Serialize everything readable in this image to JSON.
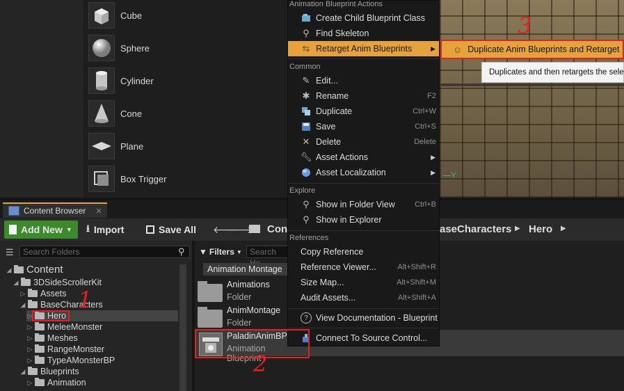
{
  "place_panel": {
    "items": [
      {
        "label": "Cube",
        "icon": "cube-icon"
      },
      {
        "label": "Sphere",
        "icon": "sphere-icon"
      },
      {
        "label": "Cylinder",
        "icon": "cylinder-icon"
      },
      {
        "label": "Cone",
        "icon": "cone-icon"
      },
      {
        "label": "Plane",
        "icon": "plane-icon"
      },
      {
        "label": "Box Trigger",
        "icon": "box-trigger-icon"
      }
    ]
  },
  "viewport": {
    "axis_label": "Y"
  },
  "context_menu": {
    "sections": [
      {
        "title": "Animation Blueprint Actions",
        "items": [
          {
            "label": "Create Child Blueprint Class",
            "icon": "blueprint-icon"
          },
          {
            "label": "Find Skeleton",
            "icon": "find-icon"
          },
          {
            "label": "Retarget Anim Blueprints",
            "icon": "retarget-icon",
            "submenu": true
          }
        ]
      },
      {
        "title": "Common",
        "items": [
          {
            "label": "Edit...",
            "icon": "edit-icon",
            "shortcut": ""
          },
          {
            "label": "Rename",
            "icon": "rename-icon",
            "shortcut": "F2"
          },
          {
            "label": "Duplicate",
            "icon": "duplicate-icon",
            "shortcut": "Ctrl+W"
          },
          {
            "label": "Save",
            "icon": "save-icon",
            "shortcut": "Ctrl+S"
          },
          {
            "label": "Delete",
            "icon": "delete-icon",
            "shortcut": "Delete"
          },
          {
            "label": "Asset Actions",
            "icon": "wrench-icon",
            "submenu": true
          },
          {
            "label": "Asset Localization",
            "icon": "globe-icon",
            "submenu": true
          }
        ]
      },
      {
        "title": "Explore",
        "items": [
          {
            "label": "Show in Folder View",
            "icon": "find-icon",
            "shortcut": "Ctrl+B"
          },
          {
            "label": "Show in Explorer",
            "icon": "find-icon",
            "shortcut": ""
          }
        ]
      },
      {
        "title": "References",
        "items": [
          {
            "label": "Copy Reference",
            "shortcut": ""
          },
          {
            "label": "Reference Viewer...",
            "shortcut": "Alt+Shift+R"
          },
          {
            "label": "Size Map...",
            "shortcut": "Alt+Shift+M"
          },
          {
            "label": "Audit Assets...",
            "shortcut": "Alt+Shift+A"
          }
        ]
      }
    ],
    "documentation": "View Documentation - Blueprint",
    "source_control": "Connect To Source Control..."
  },
  "submenu": {
    "label": "Duplicate Anim Blueprints and Retarget"
  },
  "tooltip": {
    "text": "Duplicates and then retargets the selec"
  },
  "content_browser": {
    "tab_label": "Content Browser",
    "toolbar": {
      "add_new": "Add New",
      "import": "Import",
      "save_all": "Save All"
    },
    "breadcrumb": [
      "Cont",
      "aseCharacters",
      "Hero"
    ],
    "search_folders_placeholder": "Search Folders",
    "filters_label": "Filters",
    "search_assets_placeholder": "Search He",
    "filter_chip": "Animation Montage",
    "tree": [
      {
        "label": "Content",
        "level": 0,
        "expanded": true
      },
      {
        "label": "3DSideScrollerKit",
        "level": 1,
        "expanded": true
      },
      {
        "label": "Assets",
        "level": 2,
        "expanded": false
      },
      {
        "label": "BaseCharacters",
        "level": 2,
        "expanded": true
      },
      {
        "label": "Hero",
        "level": 3,
        "expanded": false,
        "selected": true
      },
      {
        "label": "MeleeMonster",
        "level": 3,
        "expanded": false
      },
      {
        "label": "Meshes",
        "level": 3,
        "expanded": false
      },
      {
        "label": "RangeMonster",
        "level": 3,
        "expanded": false
      },
      {
        "label": "TypeAMonsterBP",
        "level": 3,
        "expanded": false
      },
      {
        "label": "Blueprints",
        "level": 2,
        "expanded": true
      },
      {
        "label": "Animation",
        "level": 3,
        "expanded": false
      }
    ],
    "assets": [
      {
        "name": "Animations",
        "type": "Folder"
      },
      {
        "name": "AnimMontage",
        "type": "Folder"
      },
      {
        "name": "PaladinAnimBP",
        "type": "Animation Blueprint"
      }
    ]
  },
  "annotations": {
    "one": "1",
    "two": "2",
    "three": "3"
  },
  "colors": {
    "highlight": "#e6a23c",
    "annotation": "#e0231f",
    "add_new": "#3d8a2c"
  }
}
